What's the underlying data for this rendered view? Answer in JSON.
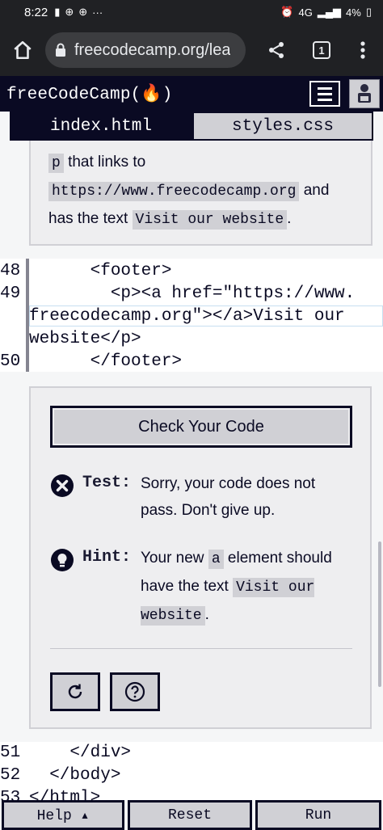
{
  "status_bar": {
    "time": "8:22",
    "network": "4G",
    "battery": "4%"
  },
  "browser": {
    "url": "freecodecamp.org/lea",
    "tab_count": "1"
  },
  "nav": {
    "logo": "freeCodeCamp(🔥)"
  },
  "file_tabs": {
    "active": "index.html",
    "inactive": "styles.css"
  },
  "instructions": {
    "line1_code": "p",
    "line1_text": " that links to",
    "line2_code": "https://www.freecodecamp.org",
    "line2_text": " and",
    "line3_text": "has the text ",
    "line3_code": "Visit our website",
    "line3_end": "."
  },
  "code_editor": {
    "lines": [
      {
        "number": "48",
        "text": "      <footer>"
      },
      {
        "number": "49",
        "text": "        <p><a href=\"https://www."
      },
      {
        "number": "",
        "text": "freecodecamp.org\"></a>Visit our"
      },
      {
        "number": "",
        "text": "website</p>"
      },
      {
        "number": "50",
        "text": "      </footer>"
      }
    ]
  },
  "feedback": {
    "check_label": "Check Your Code",
    "test_label": "Test:",
    "test_text": "Sorry, your code does not pass. Don't give up.",
    "hint_label": "Hint:",
    "hint_text_1": "Your new ",
    "hint_code_1": "a",
    "hint_text_2": " element should have the text ",
    "hint_code_2": "Visit our website",
    "hint_end": "."
  },
  "code_editor_2": {
    "lines": [
      {
        "number": "51",
        "text": "    </div>"
      },
      {
        "number": "52",
        "text": "  </body>"
      },
      {
        "number": "53",
        "text": "</html>"
      }
    ]
  },
  "action_bar": {
    "help": "Help ▴",
    "reset": "Reset",
    "run": "Run"
  }
}
